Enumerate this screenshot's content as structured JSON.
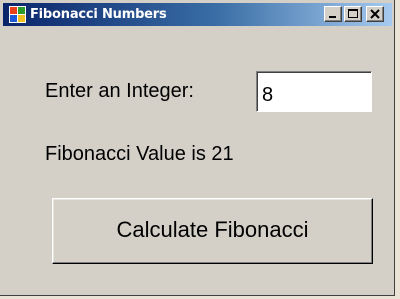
{
  "window": {
    "title": "Fibonacci Numbers",
    "app_icon": "app-window-icon",
    "controls": [
      "minimize-icon",
      "maximize-icon",
      "close-icon"
    ]
  },
  "form": {
    "input_label": "Enter an Integer:",
    "input_value": "8",
    "result_text": "Fibonacci Value is 21",
    "button_label": "Calculate Fibonacci"
  },
  "colors": {
    "title_start": "#0a246a",
    "title_end": "#a6caf0",
    "face": "#d4d0c8"
  }
}
